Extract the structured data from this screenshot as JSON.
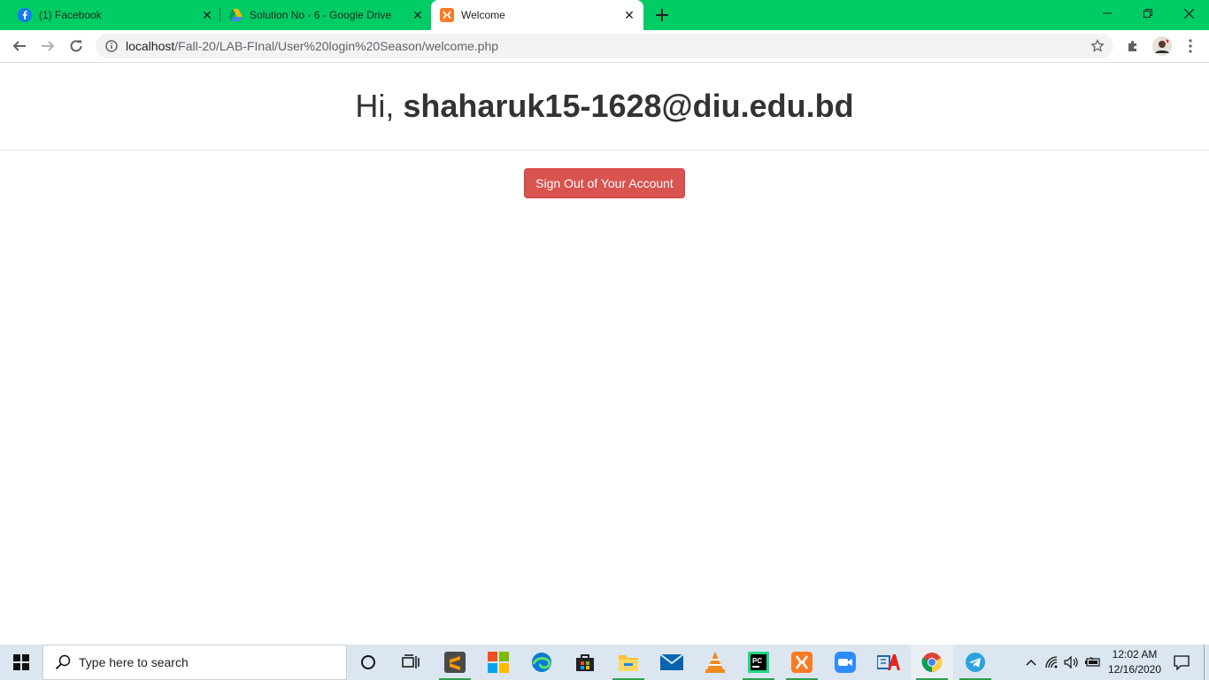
{
  "browser": {
    "tabs": [
      {
        "title": "(1) Facebook",
        "icon": "facebook-icon"
      },
      {
        "title": "Solution No - 6 - Google Drive",
        "icon": "google-drive-icon"
      },
      {
        "title": "Welcome",
        "icon": "xampp-icon"
      }
    ],
    "active_tab_index": 2,
    "address": {
      "host": "localhost",
      "path": "/Fall-20/LAB-FInal/User%20login%20Season/welcome.php"
    },
    "accent_color": "#00cc66"
  },
  "page": {
    "greeting_prefix": "Hi, ",
    "username": "shaharuk15-1628@diu.edu.bd",
    "signout_label": "Sign Out of Your Account",
    "signout_color": "#d9534f"
  },
  "taskbar": {
    "search_placeholder": "Type here to search",
    "apps": [
      "cortana-icon",
      "task-view-icon",
      "sublime-text-icon",
      "store-tiles-icon",
      "edge-icon",
      "microsoft-store-icon",
      "file-explorer-icon",
      "mail-icon",
      "vlc-icon",
      "pycharm-icon",
      "xampp-icon",
      "zoom-icon",
      "editor-icon",
      "chrome-icon",
      "telegram-icon"
    ],
    "clock": {
      "time": "12:02 AM",
      "date": "12/16/2020"
    }
  }
}
